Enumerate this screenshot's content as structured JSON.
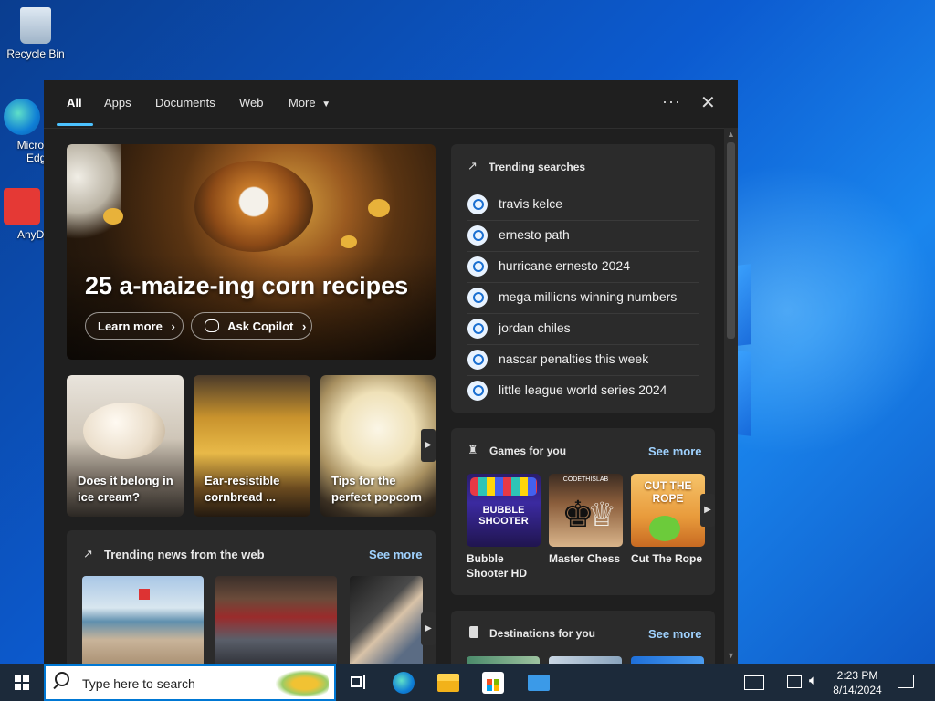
{
  "desktop": {
    "icons": [
      {
        "label": "Recycle Bin"
      },
      {
        "label": "Microsoft Edge"
      },
      {
        "label": "AnyDesk"
      }
    ]
  },
  "panel": {
    "tabs": [
      {
        "label": "All",
        "active": true
      },
      {
        "label": "Apps"
      },
      {
        "label": "Documents"
      },
      {
        "label": "Web"
      },
      {
        "label": "More"
      }
    ],
    "more_menu_icon": "ellipsis-icon",
    "close_icon": "close-icon",
    "hero": {
      "title": "25 a-maize-ing corn recipes",
      "learn_more": "Learn more",
      "ask_copilot": "Ask Copilot"
    },
    "cards": [
      {
        "caption": "Does it belong in ice cream?"
      },
      {
        "caption": "Ear-resistible cornbread ..."
      },
      {
        "caption": "Tips for the perfect popcorn"
      }
    ],
    "trending_news": {
      "title": "Trending news from the web",
      "see_more": "See more"
    },
    "trending_searches": {
      "title": "Trending searches",
      "items": [
        "travis kelce",
        "ernesto path",
        "hurricane ernesto 2024",
        "mega millions winning numbers",
        "jordan chiles",
        "nascar penalties this week",
        "little league world series 2024"
      ]
    },
    "games": {
      "title": "Games for you",
      "see_more": "See more",
      "items": [
        {
          "name": "Bubble Shooter HD",
          "tile_text": "BUBBLE SHOOTER"
        },
        {
          "name": "Master Chess",
          "tile_text": "CODETHISLAB"
        },
        {
          "name": "Cut The Rope",
          "tile_text": "CUT THE ROPE"
        }
      ]
    },
    "destinations": {
      "title": "Destinations for you",
      "see_more": "See more"
    }
  },
  "taskbar": {
    "search_placeholder": "Type here to search",
    "time": "2:23 PM",
    "date": "8/14/2024"
  },
  "colors": {
    "accent": "#4cc2ff",
    "link": "#9fd2ff",
    "panel_bg": "#1f1f1f",
    "card_bg": "#2b2b2b"
  }
}
